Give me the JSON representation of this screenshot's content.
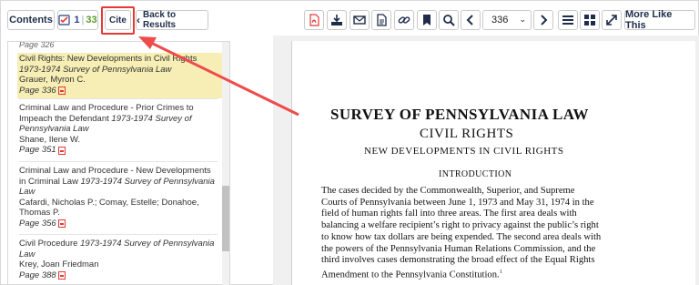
{
  "toolbar": {
    "contents_label": "Contents",
    "count_current": "1",
    "count_separator": "|",
    "count_total": "33",
    "cite_label": "Cite",
    "back_label": "Back to Results",
    "page_value": "336",
    "more_like_this_label": "More Like This",
    "icons": [
      "pdf-icon",
      "download-icon",
      "email-icon",
      "document-icon",
      "link-icon",
      "bookmark-icon",
      "search-icon",
      "chevron-left-icon",
      "chevron-right-icon",
      "list-icon",
      "grid-icon",
      "expand-icon"
    ]
  },
  "toc": {
    "partial_top": "Page 326",
    "entries": [
      {
        "title": "Civil Rights: New Developments in Civil Rights",
        "source": "1973-1974 Survey of Pennsylvania Law",
        "authors": "Grauer, Myron C.",
        "page": "Page 336",
        "selected": true
      },
      {
        "title": "Criminal Law and Procedure - Prior Crimes to Impeach the Defendant",
        "source": "1973-1974 Survey of Pennsylvania Law",
        "authors": "Shane, Ilene W.",
        "page": "Page 351"
      },
      {
        "title": "Criminal Law and Procedure - New Developments in Criminal Law",
        "source": "1973-1974 Survey of Pennsylvania Law",
        "authors": "Cafardi, Nicholas P.; Comay, Estelle; Donahoe, Thomas P.",
        "page": "Page 356"
      },
      {
        "title": "Civil Procedure",
        "source": "1973-1974 Survey of Pennsylvania Law",
        "authors": "Krey, Joan Friedman",
        "page": "Page 388"
      }
    ]
  },
  "document": {
    "title": "SURVEY OF PENNSYLVANIA LAW",
    "subtitle": "CIVIL RIGHTS",
    "subheading": "NEW DEVELOPMENTS IN CIVIL RIGHTS",
    "section": "INTRODUCTION",
    "lines": [
      "The cases decided by the Commonwealth, Superior, and Supreme",
      "Courts of Pennsylvania between June 1, 1973 and May 31, 1974 in the",
      "field of human rights fall into three areas. The first area deals with",
      "balancing a welfare recipient’s right to privacy against the public’s right",
      "to know how tax dollars are being expended. The second area deals with",
      "the powers of the Pennsylvania Human Relations Commission, and the",
      "third involves cases demonstrating the broad effect of the Equal Rights",
      "Amendment to the Pennsylvania Constitution."
    ],
    "footnote_mark": "1"
  },
  "colors": {
    "accent_red": "#e53935",
    "selected_bg": "#f6eeb4",
    "count_green": "#5a9a2a",
    "navy": "#1f2d4a"
  }
}
